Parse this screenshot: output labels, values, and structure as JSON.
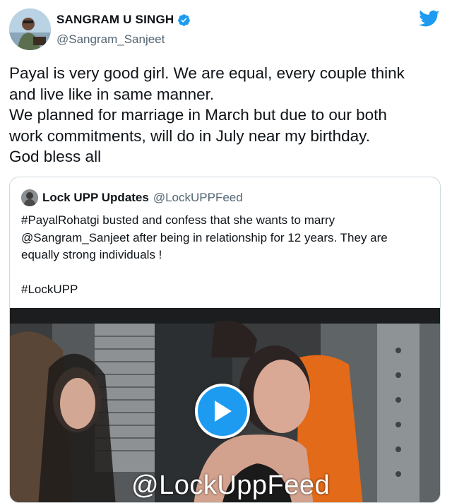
{
  "author": {
    "display_name": "SANGRAM U SINGH",
    "handle": "@Sangram_Sanjeet",
    "verified": true
  },
  "tweet": {
    "lines": [
      "Payal is very good girl. We are equal, every couple think",
      "and live like in same manner.",
      "We planned for marriage in March but due to our both",
      "work commitments, will do in July near my birthday.",
      "God bless all"
    ]
  },
  "quoted_tweet": {
    "display_name": "Lock UPP Updates",
    "handle": "@LockUPPFeed",
    "lines": [
      "#PayalRohatgi  busted and confess that she wants to marry",
      "@Sangram_Sanjeet after being in relationship for 12 years.  They are",
      "equally strong individuals !",
      "",
      "#LockUPP"
    ],
    "video": {
      "watermark": "@LockUppFeed"
    }
  },
  "icons": {
    "brand": "twitter-bird-icon",
    "verified": "verified-badge-icon",
    "play": "play-icon"
  },
  "colors": {
    "brand_blue": "#1d9bf0",
    "text_primary": "#0f1419",
    "text_secondary": "#536471",
    "card_border": "#cfd9de"
  }
}
